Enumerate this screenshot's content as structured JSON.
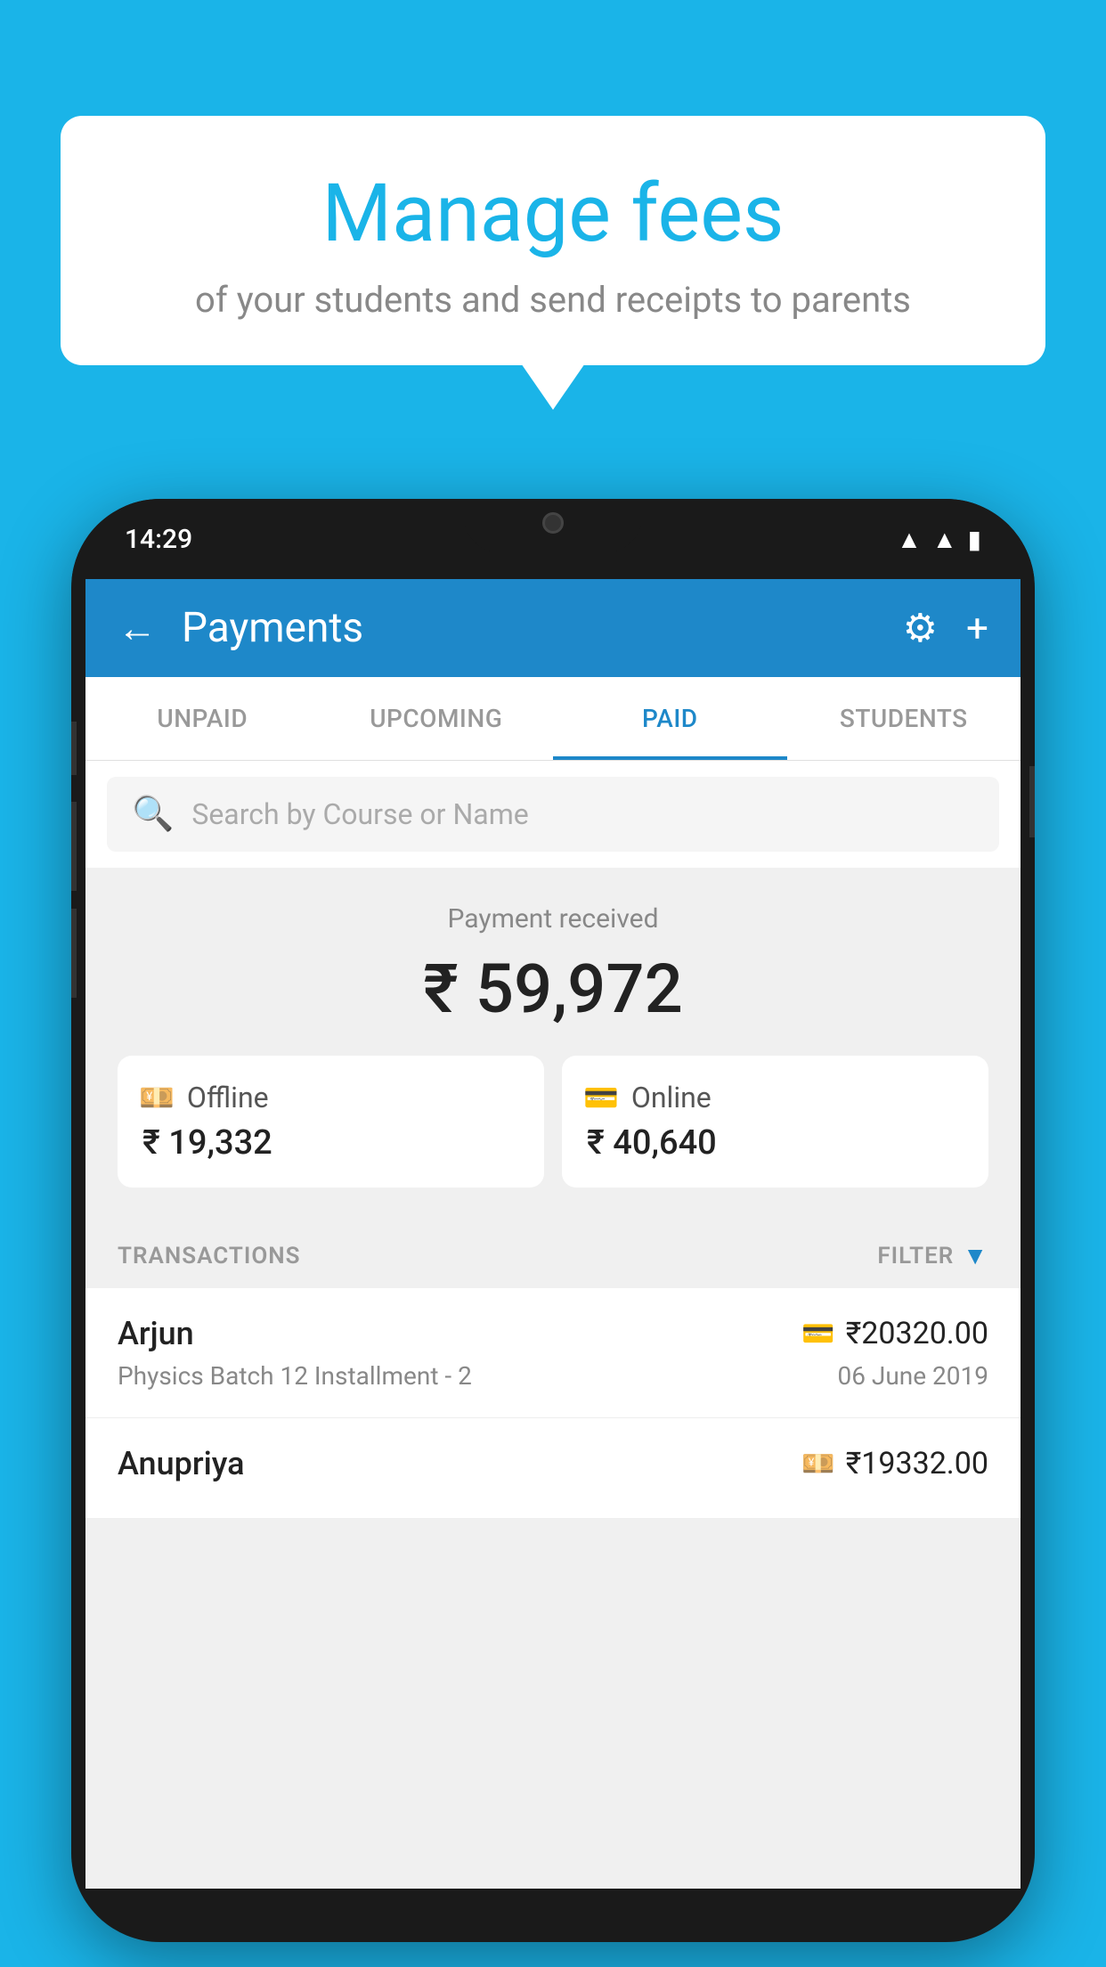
{
  "bubble": {
    "title": "Manage fees",
    "subtitle": "of your students and send receipts to parents"
  },
  "phone": {
    "status_time": "14:29"
  },
  "app_bar": {
    "title": "Payments",
    "back_label": "←",
    "settings_label": "⚙",
    "add_label": "+"
  },
  "tabs": [
    {
      "label": "UNPAID",
      "active": false
    },
    {
      "label": "UPCOMING",
      "active": false
    },
    {
      "label": "PAID",
      "active": true
    },
    {
      "label": "STUDENTS",
      "active": false
    }
  ],
  "search": {
    "placeholder": "Search by Course or Name"
  },
  "payment_summary": {
    "label": "Payment received",
    "total": "₹ 59,972",
    "offline_label": "Offline",
    "offline_amount": "₹ 19,332",
    "online_label": "Online",
    "online_amount": "₹ 40,640"
  },
  "transactions": {
    "header_label": "TRANSACTIONS",
    "filter_label": "FILTER",
    "items": [
      {
        "name": "Arjun",
        "detail": "Physics Batch 12 Installment - 2",
        "amount": "₹20320.00",
        "date": "06 June 2019",
        "payment_type": "card"
      },
      {
        "name": "Anupriya",
        "detail": "",
        "amount": "₹19332.00",
        "date": "",
        "payment_type": "cash"
      }
    ]
  }
}
